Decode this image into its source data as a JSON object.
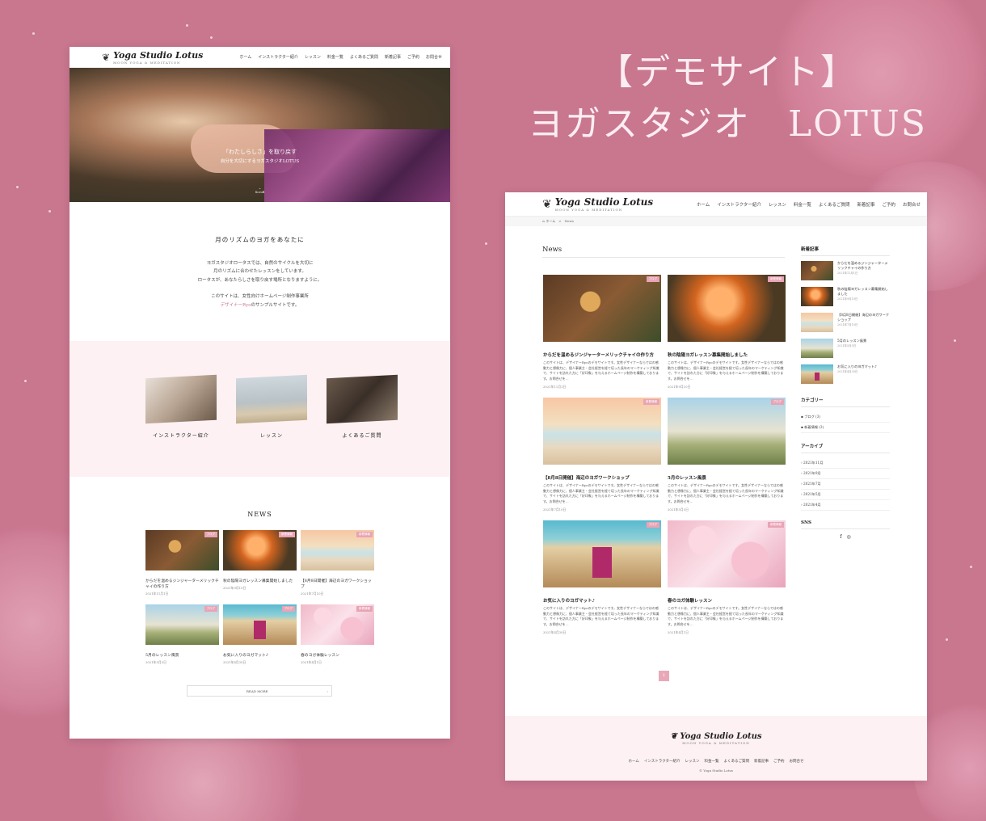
{
  "headline": {
    "line1": "【デモサイト】",
    "line2": "ヨガスタジオ　LOTUS"
  },
  "brand": {
    "name": "Yoga Studio Lotus",
    "tagline": "MOON YOGA & MEDITATION",
    "accent": "#c9768f",
    "pink_bg": "#fdf1f3",
    "tag": "#e8a4b5"
  },
  "nav": [
    "ホーム",
    "インストラクター紹介",
    "レッスン",
    "料金一覧",
    "よくあるご質問",
    "新着記事",
    "ご予約",
    "お問合せ"
  ],
  "left": {
    "hero_line1": "「わたしらしさ」を取り戻す",
    "hero_line2": "自分を大切にするヨガスタジオLOTUS",
    "scroll": "Scroll",
    "intro_title": "月のリズムのヨガをあなたに",
    "intro_p1": "ヨガスタジオロータスでは、自然のサイクルを大切に",
    "intro_p2": "月のリズムに合わせたレッスンをしています。",
    "intro_p3": "ロータスが、あなたらしさを取り戻す場所となりますように。",
    "intro_p4": "このサイトは、女性向けホームページ制作事業所",
    "intro_link": "デザイナーRyo",
    "intro_p5": "のサンプルサイトです。",
    "cards": [
      "インストラクター紹介",
      "レッスン",
      "よくあるご質問"
    ],
    "news_heading": "NEWS",
    "news": [
      {
        "title": "からだを温めるジンジャーターメリックチャイの作り方",
        "date": "2021年11月1日",
        "tag": "ブログ"
      },
      {
        "title": "秋の陰陽ヨガレッスン募集開始しました",
        "date": "2021年9月10日",
        "tag": "新着情報"
      },
      {
        "title": "【8月8日開催】海辺のヨガワークショップ",
        "date": "2021年7月10日",
        "tag": "新着情報"
      },
      {
        "title": "5月のレッスン風景",
        "date": "2021年5月5日",
        "tag": "ブログ"
      },
      {
        "title": "お気に入りのヨガマット♪",
        "date": "2021年4月30日",
        "tag": "ブログ"
      },
      {
        "title": "春のヨガ体験レッスン",
        "date": "2021年4月1日",
        "tag": "新着情報"
      }
    ],
    "read_more": "READ MORE"
  },
  "right": {
    "breadcrumb": "ホーム　>　News",
    "title": "News",
    "excerpt": "このサイトは、デザイナーRyoのデモサイトです。女性デザイナーならではの感動力と想像力に、個人事業主・会社経営を経て培った長年のマーケティング知識で、サイトを訪れた方に「好印象」を与えるホームページ制作を構築しております。お問合せを…",
    "posts": [
      {
        "title": "からだを温めるジンジャーターメリックチャイの作り方",
        "date": "2021年11月1日",
        "tag": "ブログ"
      },
      {
        "title": "秋の陰陽ヨガレッスン募集開始しました",
        "date": "2021年9月10日",
        "tag": "新着情報"
      },
      {
        "title": "【8月8日開催】海辺のヨガワークショップ",
        "date": "2021年7月10日",
        "tag": "新着情報"
      },
      {
        "title": "5月のレッスン風景",
        "date": "2021年5月5日",
        "tag": "ブログ"
      },
      {
        "title": "お気に入りのヨガマット♪",
        "date": "2021年4月30日",
        "tag": "ブログ"
      },
      {
        "title": "春のヨガ体験レッスン",
        "date": "2021年4月1日",
        "tag": "新着情報"
      }
    ],
    "page": "1",
    "sidebar": {
      "recent_title": "新着記事",
      "recent": [
        {
          "title": "からだを温めるジンジャーターメリックチャイの作り方",
          "date": "2021年11月1日"
        },
        {
          "title": "秋の陰陽ヨガレッスン募集開始しました",
          "date": "2021年9月10日"
        },
        {
          "title": "【8月8日開催】海辺のヨガワークショップ",
          "date": "2021年7月10日"
        },
        {
          "title": "5月のレッスン風景",
          "date": "2021年5月5日"
        },
        {
          "title": "お気に入りのヨガマット♪",
          "date": "2021年4月30日"
        }
      ],
      "category_title": "カテゴリー",
      "categories": [
        "ブログ (3)",
        "新着情報 (3)"
      ],
      "archive_title": "アーカイブ",
      "archives": [
        "2021年11月",
        "2021年9月",
        "2021年7月",
        "2021年5月",
        "2021年4月"
      ],
      "sns_title": "SNS",
      "sns_icons": [
        "facebook-icon",
        "instagram-icon"
      ]
    },
    "footer_nav": [
      "ホーム",
      "インストラクター紹介",
      "レッスン",
      "料金一覧",
      "よくあるご質問",
      "新着記事",
      "ご予約",
      "お問合せ"
    ],
    "copyright": "© Yoga Studio Lotus"
  }
}
